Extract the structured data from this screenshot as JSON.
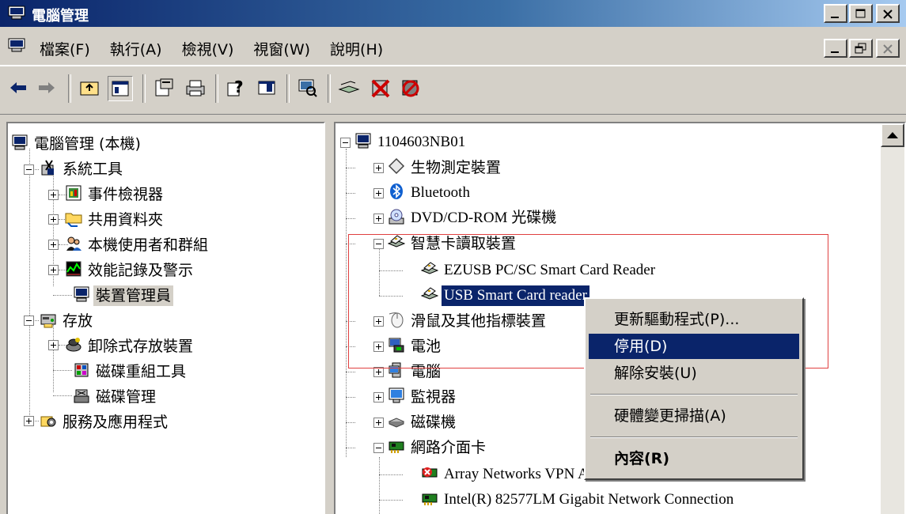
{
  "window": {
    "title": "電腦管理"
  },
  "menubar": {
    "items": [
      "檔案(F)",
      "執行(A)",
      "檢視(V)",
      "視窗(W)",
      "說明(H)"
    ]
  },
  "toolbar": {
    "buttons": [
      "back-icon",
      "forward-icon",
      "up-folder-icon",
      "show-hide-tree-icon",
      "properties-icon",
      "print-icon",
      "help-icon",
      "console-view-icon",
      "scan-hardware-icon",
      "update-driver-icon",
      "disable-device-icon",
      "uninstall-device-icon"
    ]
  },
  "left_tree": {
    "root": "電腦管理 (本機)",
    "system_tools": "系統工具",
    "event_viewer": "事件檢視器",
    "shared_folders": "共用資料夾",
    "local_users": "本機使用者和群組",
    "perf_logs": "效能記錄及警示",
    "device_manager": "裝置管理員",
    "storage": "存放",
    "removable_storage": "卸除式存放裝置",
    "defrag": "磁碟重組工具",
    "disk_mgmt": "磁碟管理",
    "services_apps": "服務及應用程式"
  },
  "right_tree": {
    "computer": "1104603NB01",
    "biometric": "生物測定裝置",
    "bluetooth": "Bluetooth",
    "dvd": "DVD/CD-ROM 光碟機",
    "smartcard": "智慧卡讀取裝置",
    "ezusb": "EZUSB PC/SC Smart Card Reader",
    "usb_reader": "USB Smart Card reader",
    "mice": "滑鼠及其他指標裝置",
    "battery": "電池",
    "computer_cat": "電腦",
    "monitor": "監視器",
    "disk_drive": "磁碟機",
    "network": "網路介面卡",
    "array_net": "Array Networks VPN Adapter",
    "intel_net": "Intel(R) 82577LM Gigabit Network Connection"
  },
  "context_menu": {
    "update_driver": "更新驅動程式(P)...",
    "disable": "停用(D)",
    "uninstall": "解除安裝(U)",
    "scan_changes": "硬體變更掃描(A)",
    "properties": "內容(R)"
  },
  "colors": {
    "title_active": "#0a246a",
    "selection": "#0a246a",
    "highlight_box": "#e04040",
    "face": "#d4d0c8"
  }
}
